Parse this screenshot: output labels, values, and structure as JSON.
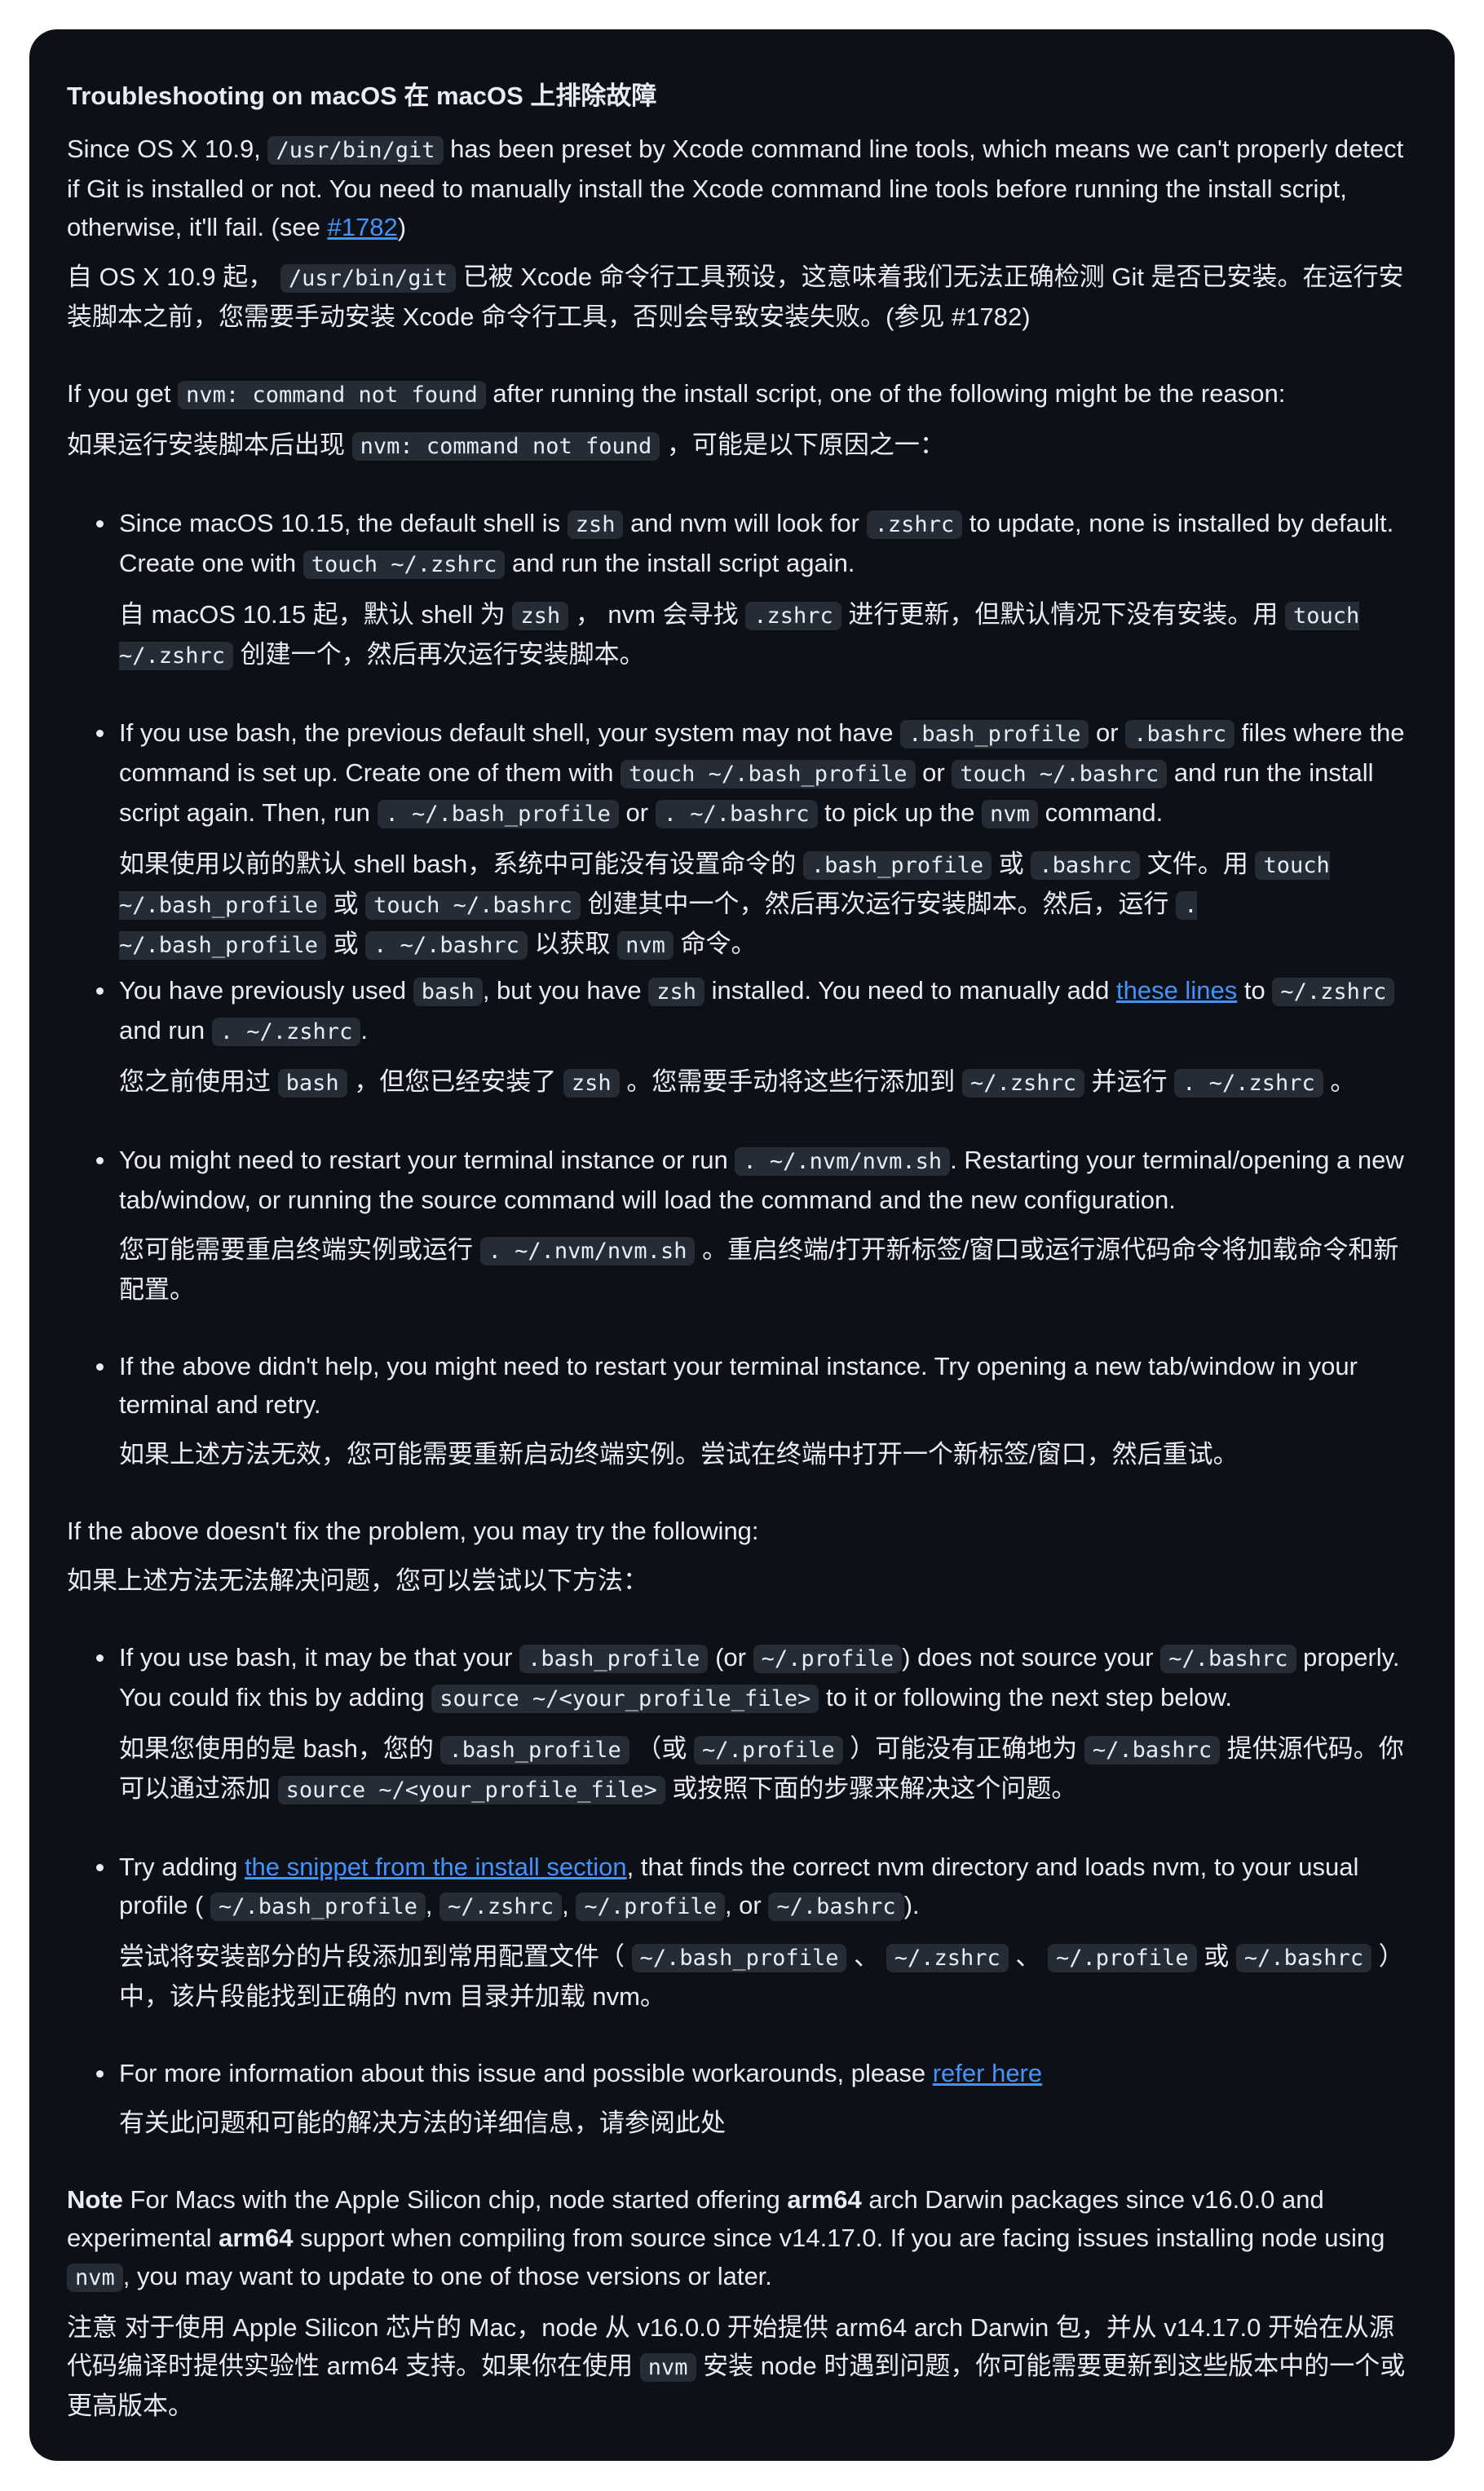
{
  "heading": "Troubleshooting on macOS  在 macOS 上排除故障",
  "p1": {
    "a": "Since OS X 10.9,",
    "code1": "/usr/bin/git",
    "b": "has been preset by Xcode command line tools, which means we can't properly detect if Git is installed or not. You need to manually install the Xcode command line tools before running the install script, otherwise, it'll fail. (see",
    "link": "#1782",
    "c": ")"
  },
  "p1zh": {
    "a": "自 OS X 10.9 起，",
    "code1": "/usr/bin/git",
    "b": "已被 Xcode 命令行工具预设，这意味着我们无法正确检测 Git 是否已安装。在运行安装脚本之前，您需要手动安装 Xcode 命令行工具，否则会导致安装失败。(参见 #1782)"
  },
  "p2": {
    "a": "If you get",
    "code1": "nvm: command not found",
    "b": "after running the install script, one of the following might be the reason:"
  },
  "p2zh": {
    "a": "如果运行安装脚本后出现",
    "code1": "nvm: command not found",
    "b": "，可能是以下原因之一："
  },
  "list1": {
    "i1": {
      "a": "Since macOS 10.15, the default shell is",
      "c1": "zsh",
      "b": "and nvm will look for",
      "c2": ".zshrc",
      "c": "to update, none is installed by default. Create one with",
      "c3": "touch ~/.zshrc",
      "d": "and run the install script again.",
      "zh_a": "自 macOS 10.15 起，默认 shell 为",
      "zh_c1": "zsh",
      "zh_b": "， nvm 会寻找",
      "zh_c2": ".zshrc",
      "zh_c": "进行更新，但默认情况下没有安装。用",
      "zh_c3": "touch ~/.zshrc",
      "zh_d": "创建一个，然后再次运行安装脚本。"
    },
    "i2": {
      "a": "If you use bash, the previous default shell, your system may not have",
      "c1": ".bash_profile",
      "b": "or",
      "c2": ".bashrc",
      "c": "files where the command is set up. Create one of them with",
      "c3": "touch ~/.bash_profile",
      "d": "or",
      "c4": "touch ~/.bashrc",
      "e": "and run the install script again. Then, run",
      "c5": ". ~/.bash_profile",
      "f": "or",
      "c6": ". ~/.bashrc",
      "g": "to pick up the",
      "c7": "nvm",
      "h": "command.",
      "zh_a": "如果使用以前的默认 shell bash，系统中可能没有设置命令的",
      "zh_c1": ".bash_profile",
      "zh_b": "或",
      "zh_c2": ".bashrc",
      "zh_c": "文件。用",
      "zh_c3": "touch ~/.bash_profile",
      "zh_d": "或",
      "zh_c4": "touch ~/.bashrc",
      "zh_e": "创建其中一个，然后再次运行安装脚本。然后，运行",
      "zh_c5": ". ~/.bash_profile",
      "zh_f": "或",
      "zh_c6": ". ~/.bashrc",
      "zh_g": "以获取",
      "zh_c7": "nvm",
      "zh_h": "命令。"
    },
    "i3": {
      "a": "You have previously used",
      "c1": "bash",
      "b": ", but you have",
      "c2": "zsh",
      "c": "installed. You need to manually add",
      "link": "these lines",
      "d": "to",
      "c3": "~/.zshrc",
      "e": "and run",
      "c4": ". ~/.zshrc",
      "f": ".",
      "zh_a": "您之前使用过",
      "zh_c1": "bash",
      "zh_b": "，但您已经安装了",
      "zh_c2": "zsh",
      "zh_c": "。您需要手动将这些行添加到",
      "zh_c3": "~/.zshrc",
      "zh_d": "并运行",
      "zh_c4": ". ~/.zshrc",
      "zh_e": "。"
    },
    "i4": {
      "a": "You might need to restart your terminal instance or run",
      "c1": ". ~/.nvm/nvm.sh",
      "b": ". Restarting your terminal/opening a new tab/window, or running the source command will load the command and the new configuration.",
      "zh_a": "您可能需要重启终端实例或运行",
      "zh_c1": ". ~/.nvm/nvm.sh",
      "zh_b": "。重启终端/打开新标签/窗口或运行源代码命令将加载命令和新配置。"
    },
    "i5": {
      "a": "If the above didn't help, you might need to restart your terminal instance. Try opening a new tab/window in your terminal and retry.",
      "zh_a": "如果上述方法无效，您可能需要重新启动终端实例。尝试在终端中打开一个新标签/窗口，然后重试。"
    }
  },
  "p3": "If the above doesn't fix the problem, you may try the following:",
  "p3zh": "如果上述方法无法解决问题，您可以尝试以下方法：",
  "list2": {
    "i1": {
      "a": "If you use bash, it may be that your",
      "c1": ".bash_profile",
      "b": "(or",
      "c2": "~/.profile",
      "c": ") does not source your",
      "c3": "~/.bashrc",
      "d": "properly. You could fix this by adding",
      "c4": "source ~/<your_profile_file>",
      "e": "to it or following the next step below.",
      "zh_a": "如果您使用的是 bash，您的",
      "zh_c1": ".bash_profile",
      "zh_b": "（或",
      "zh_c2": "~/.profile",
      "zh_c": "）可能没有正确地为",
      "zh_c3": "~/.bashrc",
      "zh_d": "提供源代码。你可以通过添加",
      "zh_c4": "source ~/<your_profile_file>",
      "zh_e": "或按照下面的步骤来解决这个问题。"
    },
    "i2": {
      "a": "Try adding",
      "link": "the snippet from the install section",
      "b": ", that finds the correct nvm directory and loads nvm, to your usual profile (",
      "c1": "~/.bash_profile",
      "c": ",",
      "c2": "~/.zshrc",
      "d": ",",
      "c3": "~/.profile",
      "e": ", or",
      "c4": "~/.bashrc",
      "f": ").",
      "zh_a": "尝试将安装部分的片段添加到常用配置文件（",
      "zh_c1": "~/.bash_profile",
      "zh_b": "、",
      "zh_c2": "~/.zshrc",
      "zh_c": "、",
      "zh_c3": "~/.profile",
      "zh_d": "或",
      "zh_c4": "~/.bashrc",
      "zh_e": "）中，该片段能找到正确的 nvm 目录并加载 nvm。"
    },
    "i3": {
      "a": "For more information about this issue and possible workarounds, please",
      "link": "refer here",
      "zh_a": "有关此问题和可能的解决方法的详细信息，请参阅此处"
    }
  },
  "note": {
    "label": "Note",
    "a": "For Macs with the Apple Silicon chip, node started offering",
    "b1": "arm64",
    "b": "arch Darwin packages since v16.0.0 and experimental",
    "b2": "arm64",
    "c": "support when compiling from source since v14.17.0. If you are facing issues installing node using",
    "c1": "nvm",
    "d": ", you may want to update to one of those versions or later.",
    "zh_a": "注意 对于使用 Apple Silicon 芯片的 Mac，node 从 v16.0.0 开始提供 arm64 arch Darwin 包，并从 v14.17.0 开始在从源代码编译时提供实验性 arm64 支持。如果你在使用",
    "zh_c1": "nvm",
    "zh_b": "安装 node 时遇到问题，你可能需要更新到这些版本中的一个或更高版本。"
  },
  "colors": {
    "background": "#0d1117",
    "text": "#e6edf3",
    "link": "#4493f8",
    "code_bg": "#262c36"
  }
}
